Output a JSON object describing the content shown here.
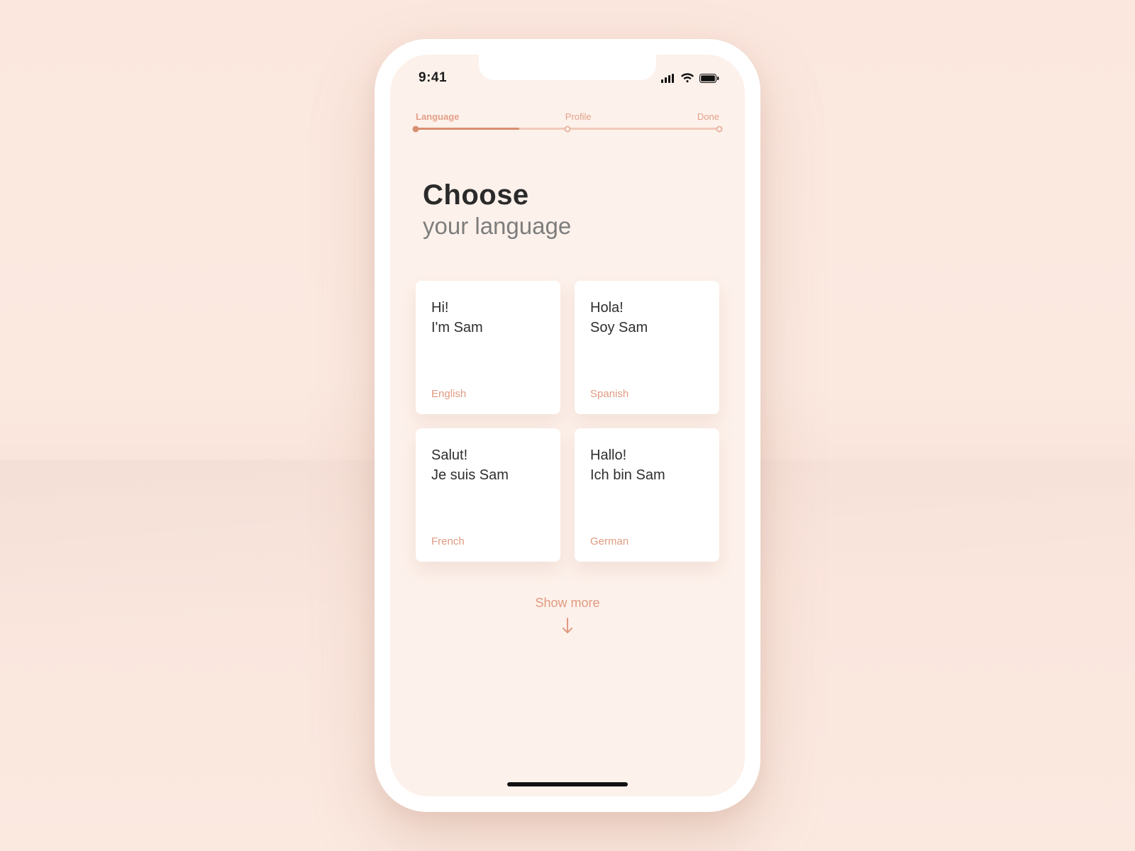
{
  "statusbar": {
    "time": "9:41"
  },
  "stepper": {
    "steps": [
      "Language",
      "Profile",
      "Done"
    ]
  },
  "heading": {
    "line1": "Choose",
    "line2": "your language"
  },
  "cards": [
    {
      "greet1": "Hi!",
      "greet2": "I'm Sam",
      "lang": "English"
    },
    {
      "greet1": "Hola!",
      "greet2": "Soy Sam",
      "lang": "Spanish"
    },
    {
      "greet1": "Salut!",
      "greet2": "Je suis Sam",
      "lang": "French"
    },
    {
      "greet1": "Hallo!",
      "greet2": "Ich bin Sam",
      "lang": "German"
    }
  ],
  "showmore": {
    "label": "Show more"
  }
}
